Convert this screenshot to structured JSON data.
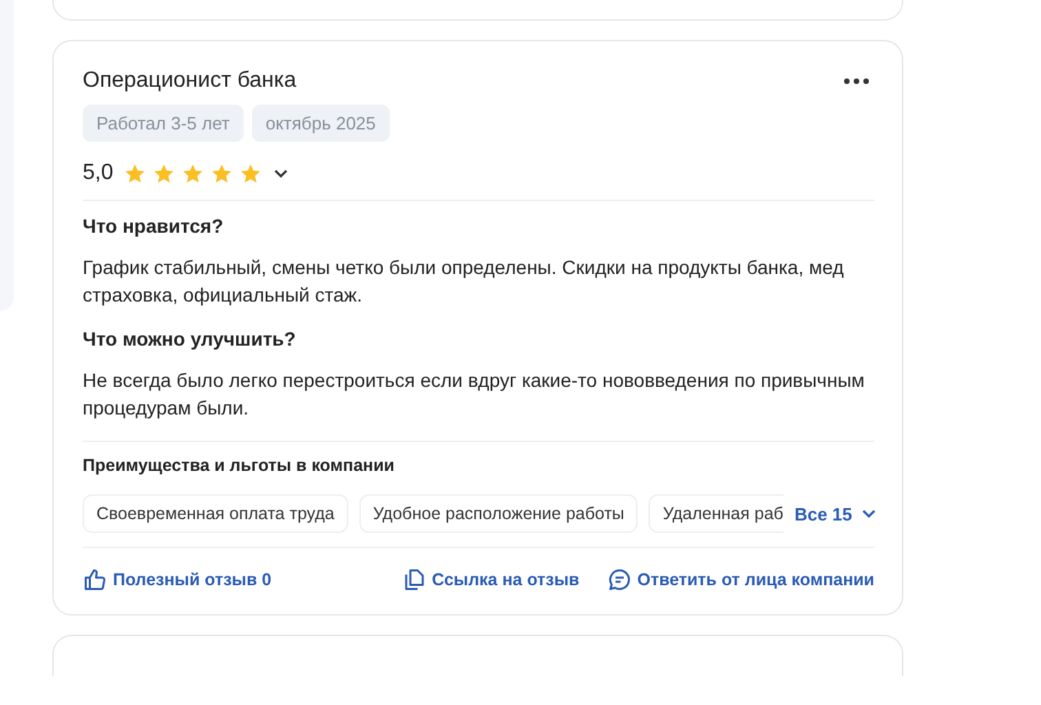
{
  "review": {
    "title": "Операционист банка",
    "tags": [
      "Работал 3-5 лет",
      "октябрь 2025"
    ],
    "rating": "5,0",
    "stars": 5,
    "sections": [
      {
        "heading": "Что нравится?",
        "text": "График стабильный, смены четко были определены. Скидки на продукты банка, мед страховка, официальный стаж."
      },
      {
        "heading": "Что можно улучшить?",
        "text": "Не всегда было легко перестроиться если вдруг какие-то нововведения по привычным процедурам были."
      }
    ],
    "benefits_title": "Преимущества и льготы в компании",
    "benefits": [
      "Своевременная оплата труда",
      "Удобное расположение работы",
      "Удаленная раб"
    ],
    "benefits_more": "Все 15",
    "actions": [
      {
        "kind": "like",
        "label": "Полезный отзыв 0"
      },
      {
        "kind": "link",
        "label": "Ссылка на отзыв"
      },
      {
        "kind": "reply",
        "label": "Ответить от лица компании"
      }
    ]
  }
}
